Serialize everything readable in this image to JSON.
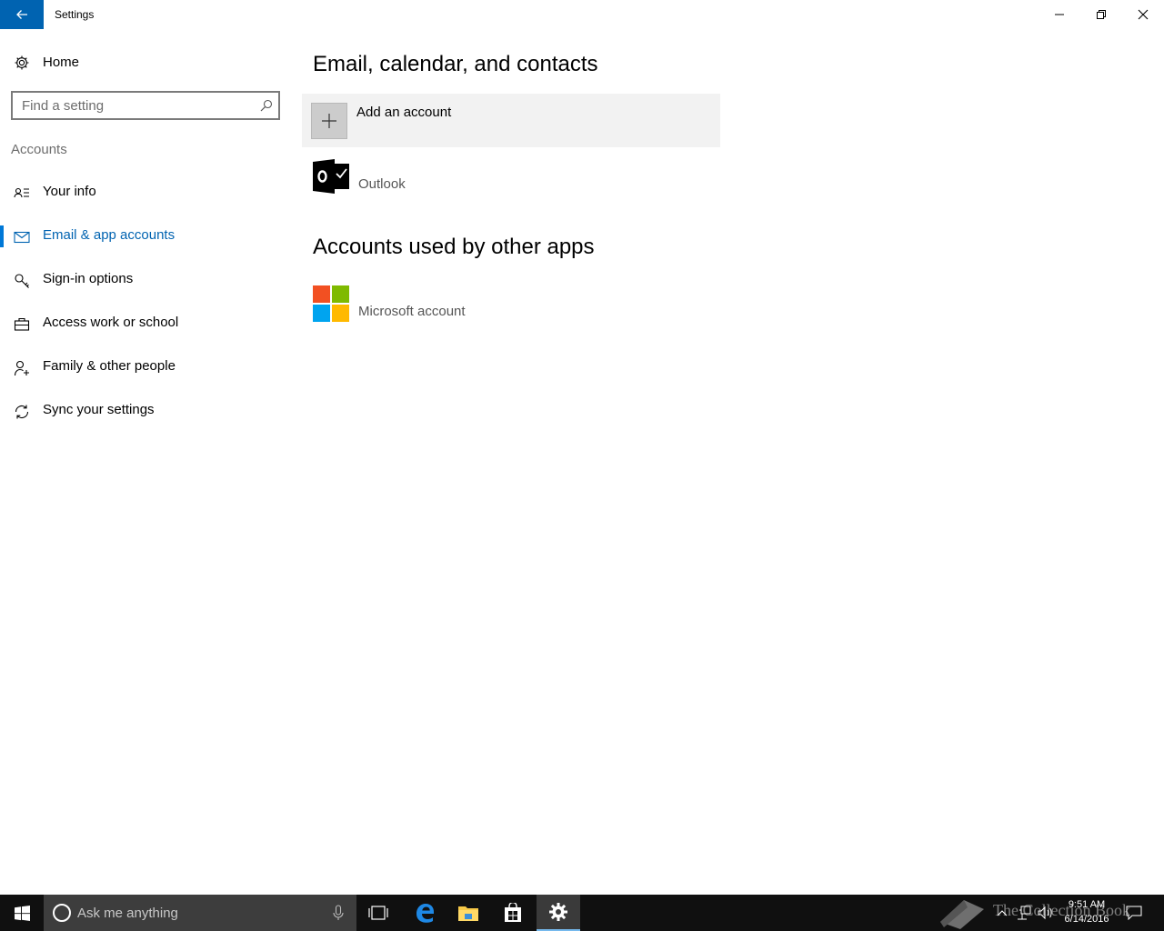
{
  "window": {
    "title": "Settings"
  },
  "sidebar": {
    "home_label": "Home",
    "search_placeholder": "Find a setting",
    "section_label": "Accounts",
    "items": [
      {
        "label": "Your info",
        "icon": "contact-info-icon",
        "selected": false
      },
      {
        "label": "Email & app accounts",
        "icon": "mail-icon",
        "selected": true
      },
      {
        "label": "Sign-in options",
        "icon": "key-icon",
        "selected": false
      },
      {
        "label": "Access work or school",
        "icon": "briefcase-icon",
        "selected": false
      },
      {
        "label": "Family & other people",
        "icon": "add-person-icon",
        "selected": false
      },
      {
        "label": "Sync your settings",
        "icon": "sync-icon",
        "selected": false
      }
    ]
  },
  "main": {
    "email_heading": "Email, calendar, and contacts",
    "add_account_label": "Add an account",
    "email_accounts": [
      {
        "label": "Outlook",
        "icon": "outlook-icon"
      }
    ],
    "other_apps_heading": "Accounts used by other apps",
    "other_accounts": [
      {
        "label": "Microsoft account",
        "icon": "microsoft-logo-icon"
      }
    ]
  },
  "taskbar": {
    "search_placeholder": "Ask me anything",
    "apps": [
      {
        "name": "task-view",
        "icon": "task-view-icon"
      },
      {
        "name": "edge",
        "icon": "edge-icon"
      },
      {
        "name": "file-explorer",
        "icon": "folder-icon"
      },
      {
        "name": "store",
        "icon": "store-icon"
      },
      {
        "name": "settings",
        "icon": "gear-icon",
        "active": true
      }
    ],
    "time": "9:51 AM",
    "date": "6/14/2016",
    "watermark": "The Collection Book"
  },
  "colors": {
    "accent": "#0063b1",
    "selected_bar": "#0078d7",
    "taskbar": "#101010",
    "add_account_bg": "#f2f2f2",
    "ms_red": "#f25022",
    "ms_green": "#7fba00",
    "ms_blue": "#00a4ef",
    "ms_yellow": "#ffb900"
  }
}
